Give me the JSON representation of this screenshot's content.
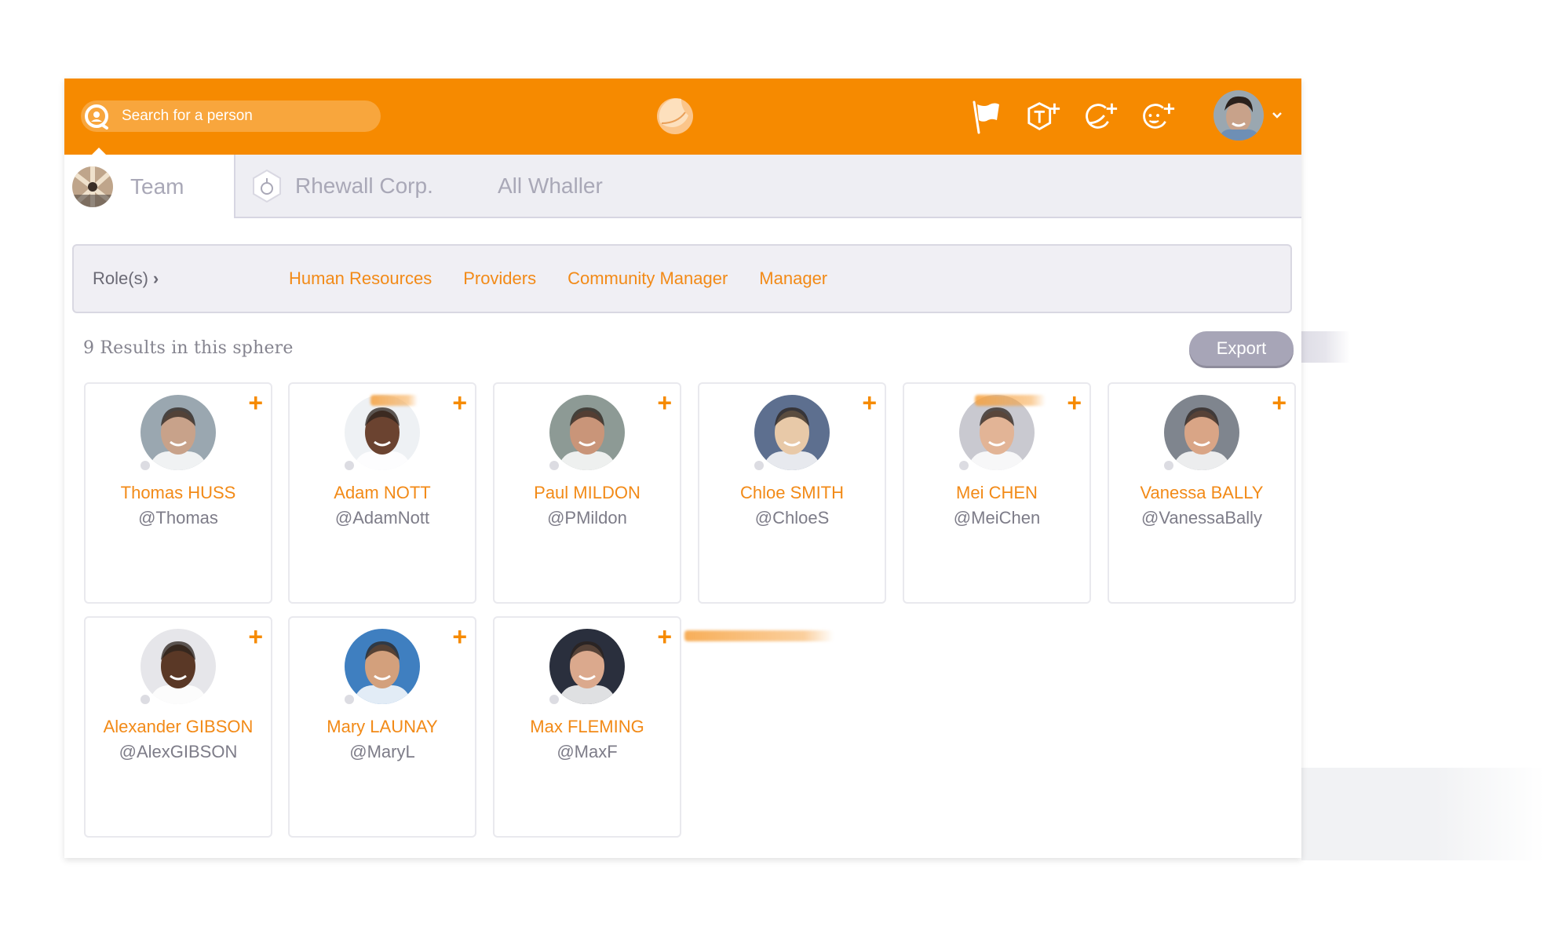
{
  "header": {
    "search_placeholder": "Search for a person",
    "icons": [
      "at-search-icon",
      "app-logo-icon",
      "flag-icon",
      "add-sphere-icon",
      "add-channel-icon",
      "add-contact-icon",
      "user-avatar",
      "chevron-down-icon"
    ],
    "accent_color": "#f68a00"
  },
  "tabs": [
    {
      "label": "Team",
      "active": true
    },
    {
      "label": "Rhewall Corp.",
      "active": false
    },
    {
      "label": "All Whaller",
      "active": false
    }
  ],
  "roles": {
    "label": "Role(s)",
    "chevron": "›",
    "items": [
      "Human Resources",
      "Providers",
      "Community Manager",
      "Manager"
    ]
  },
  "results": {
    "text": "9 Results in this sphere",
    "export_label": "Export"
  },
  "people": [
    {
      "name": "Thomas HUSS",
      "handle": "@Thomas",
      "tone": "#c8a28a",
      "bg": "#9aa7b0"
    },
    {
      "name": "Adam NOTT",
      "handle": "@AdamNott",
      "tone": "#6b4330",
      "bg": "#eef1f4"
    },
    {
      "name": "Paul MILDON",
      "handle": "@PMildon",
      "tone": "#c99579",
      "bg": "#8d9a95"
    },
    {
      "name": "Chloe SMITH",
      "handle": "@ChloeS",
      "tone": "#e8c9a8",
      "bg": "#5d6f8f"
    },
    {
      "name": "Mei CHEN",
      "handle": "@MeiChen",
      "tone": "#e2b496",
      "bg": "#c9c9d0"
    },
    {
      "name": "Vanessa BALLY",
      "handle": "@VanessaBally",
      "tone": "#d9a586",
      "bg": "#7f858e"
    },
    {
      "name": "Alexander GIBSON",
      "handle": "@AlexGIBSON",
      "tone": "#5a3826",
      "bg": "#e6e6ea"
    },
    {
      "name": "Mary LAUNAY",
      "handle": "@MaryL",
      "tone": "#d3a07c",
      "bg": "#3f7fc0"
    },
    {
      "name": "Max FLEMING",
      "handle": "@MaxF",
      "tone": "#dba98d",
      "bg": "#2a2f3d"
    }
  ],
  "card_add_label": "+"
}
